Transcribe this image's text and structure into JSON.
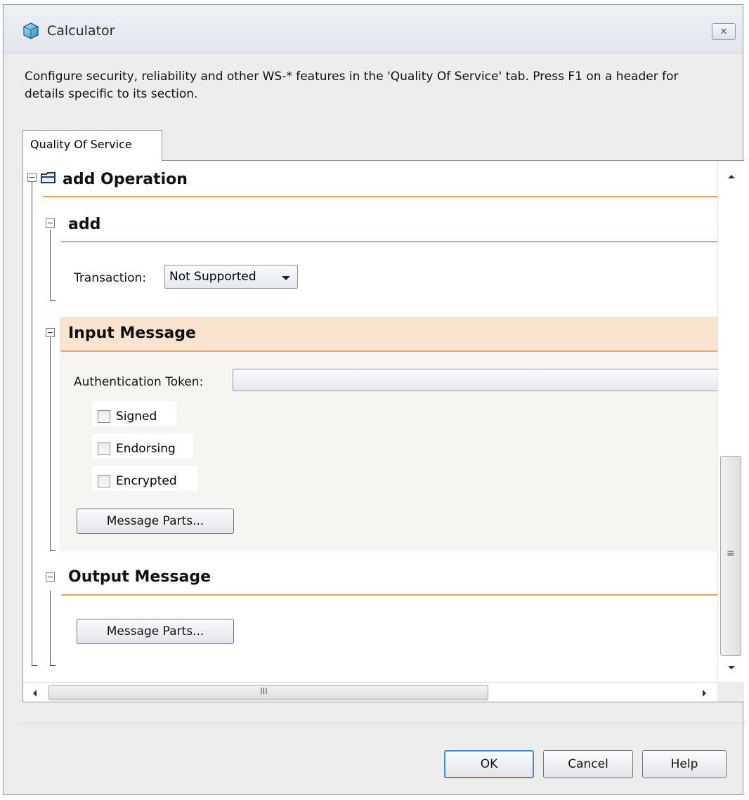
{
  "window": {
    "title": "Calculator",
    "close_glyph": "✕"
  },
  "description": "Configure security, reliability and other WS-* features in the 'Quality Of Service' tab. Press F1 on a header for details specific to its section.",
  "tabs": [
    {
      "label": "Quality Of Service",
      "selected": true
    }
  ],
  "operation": {
    "title": "add Operation",
    "sections": {
      "add": {
        "title": "add",
        "transaction_label": "Transaction:",
        "transaction_value": "Not Supported"
      },
      "input": {
        "title": "Input Message",
        "auth_label": "Authentication Token:",
        "auth_value": "",
        "checkboxes": [
          {
            "label": "Signed",
            "checked": false
          },
          {
            "label": "Endorsing",
            "checked": false
          },
          {
            "label": "Encrypted",
            "checked": false
          }
        ],
        "parts_button": "Message Parts..."
      },
      "output": {
        "title": "Output Message",
        "parts_button": "Message Parts..."
      }
    }
  },
  "scrollbars": {
    "hscroll_grip": "III",
    "vscroll_grip": "≡"
  },
  "buttons": {
    "ok": "OK",
    "cancel": "Cancel",
    "help": "Help"
  },
  "colors": {
    "section_rule": "#e7a366",
    "input_header_bg": "#fae4d0",
    "input_body_bg": "#f7f5f2"
  }
}
